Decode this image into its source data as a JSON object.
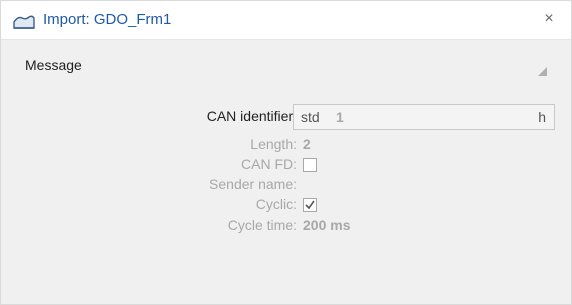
{
  "window": {
    "title": "Import: GDO_Frm1",
    "title_icon": "waveform-icon",
    "close_glyph": "×"
  },
  "section": {
    "title": "Message"
  },
  "fields": {
    "can_identifier": {
      "label": "CAN identifier:",
      "prefix": "std",
      "value": "1",
      "suffix": "h"
    },
    "length": {
      "label": "Length:",
      "value": "2"
    },
    "can_fd": {
      "label": "CAN FD:",
      "checked": false
    },
    "sender_name": {
      "label": "Sender name:",
      "value": ""
    },
    "cyclic": {
      "label": "Cyclic:",
      "checked": true
    },
    "cycle_time": {
      "label": "Cycle time:",
      "value": "200 ms"
    }
  },
  "colors": {
    "title_text": "#1e5aa8",
    "panel_bg": "#f0f0f0",
    "disabled_text": "#a8a8a8"
  }
}
